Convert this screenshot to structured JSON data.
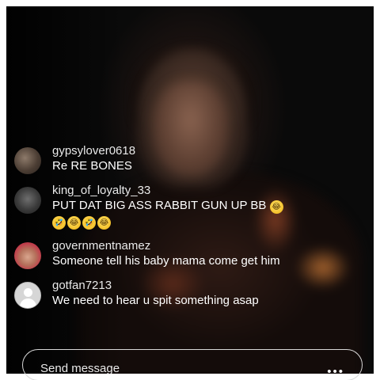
{
  "comments": [
    {
      "username": "gypsylover0618",
      "text": "Re RE BONES",
      "emoji_line": ""
    },
    {
      "username": "king_of_loyalty_33",
      "text": "PUT DAT BIG ASS RABBIT GUN UP BB",
      "emoji_line": "🤣😂🤣😂"
    },
    {
      "username": "governmentnamez",
      "text": "Someone tell his baby mama come get him",
      "emoji_line": ""
    },
    {
      "username": "gotfan7213",
      "text": "We need to hear u spit something asap",
      "emoji_line": ""
    }
  ],
  "trailing_emoji": "😂",
  "send": {
    "placeholder": "Send message",
    "more_icon": "more-dots-icon"
  },
  "colors": {
    "background": "#0a0a0a",
    "text": "#ffffff",
    "username": "#e9e9e9"
  }
}
